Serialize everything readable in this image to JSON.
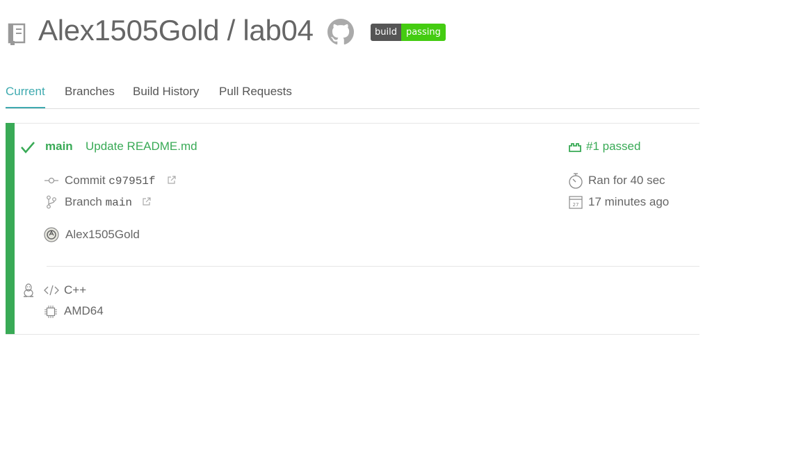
{
  "header": {
    "owner": "Alex1505Gold",
    "separator": "/",
    "repo": "lab04",
    "badge_left": "build",
    "badge_right": "passing"
  },
  "tabs": [
    {
      "label": "Current",
      "active": true
    },
    {
      "label": "Branches",
      "active": false
    },
    {
      "label": "Build History",
      "active": false
    },
    {
      "label": "Pull Requests",
      "active": false
    }
  ],
  "build": {
    "status": "passed",
    "branch_name": "main",
    "commit_message": "Update README.md",
    "build_label": "#1 passed",
    "commit_label": "Commit",
    "commit_sha": "c97951f",
    "branch_label": "Branch",
    "branch_value": "main",
    "author": "Alex1505Gold",
    "duration": "Ran for 40 sec",
    "finished": "17 minutes ago",
    "calendar_day": "27",
    "language": "C++",
    "arch": "AMD64"
  },
  "colors": {
    "passed": "#39aa56",
    "tab_active": "#3eaaaf",
    "badge_dark": "#555555",
    "badge_green": "#44cc11"
  },
  "icons": [
    "repo-icon",
    "github-icon",
    "check-icon",
    "build-status-icon",
    "commit-icon",
    "branch-icon",
    "external-link-icon",
    "avatar",
    "stopwatch-icon",
    "calendar-icon",
    "linux-icon",
    "code-icon",
    "cpu-icon"
  ]
}
